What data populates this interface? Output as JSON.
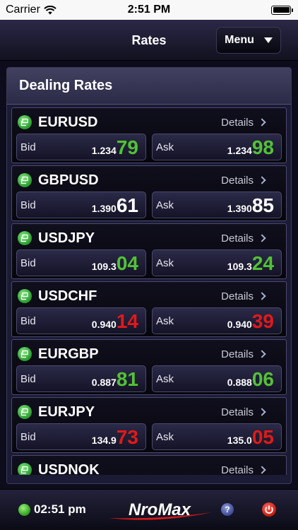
{
  "status_bar": {
    "carrier": "Carrier",
    "time": "2:51 PM"
  },
  "nav": {
    "title": "Rates",
    "menu_label": "Menu"
  },
  "panel": {
    "title": "Dealing Rates"
  },
  "labels": {
    "bid": "Bid",
    "ask": "Ask",
    "details": "Details"
  },
  "rates": [
    {
      "pair": "EURUSD",
      "bid_base": "1.234",
      "bid_pips": "79",
      "bid_dir": "up",
      "ask_base": "1.234",
      "ask_pips": "98",
      "ask_dir": "up"
    },
    {
      "pair": "GBPUSD",
      "bid_base": "1.390",
      "bid_pips": "61",
      "bid_dir": "neutral",
      "ask_base": "1.390",
      "ask_pips": "85",
      "ask_dir": "neutral"
    },
    {
      "pair": "USDJPY",
      "bid_base": "109.3",
      "bid_pips": "04",
      "bid_dir": "up",
      "ask_base": "109.3",
      "ask_pips": "24",
      "ask_dir": "up"
    },
    {
      "pair": "USDCHF",
      "bid_base": "0.940",
      "bid_pips": "14",
      "bid_dir": "down",
      "ask_base": "0.940",
      "ask_pips": "39",
      "ask_dir": "down"
    },
    {
      "pair": "EURGBP",
      "bid_base": "0.887",
      "bid_pips": "81",
      "bid_dir": "up",
      "ask_base": "0.888",
      "ask_pips": "06",
      "ask_dir": "up"
    },
    {
      "pair": "EURJPY",
      "bid_base": "134.9",
      "bid_pips": "73",
      "bid_dir": "down",
      "ask_base": "135.0",
      "ask_pips": "05",
      "ask_dir": "down"
    },
    {
      "pair": "USDNOK",
      "bid_base": "",
      "bid_pips": "",
      "bid_dir": "neutral",
      "ask_base": "",
      "ask_pips": "",
      "ask_dir": "neutral"
    }
  ],
  "footer": {
    "clock": "02:51 pm",
    "brand": "NroMax",
    "help_icon": "help-icon",
    "power_icon": "power-icon"
  },
  "colors": {
    "up": "#52c235",
    "down": "#e01a18",
    "neutral": "#ffffff",
    "accent": "#1c1b35"
  }
}
